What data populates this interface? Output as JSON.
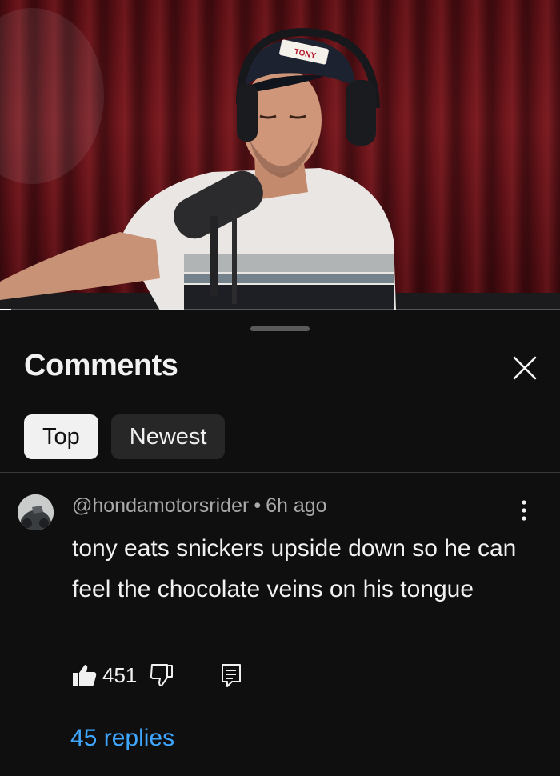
{
  "video": {
    "cap_text": "TONY",
    "progress_fraction": 0.02
  },
  "sheet": {
    "title": "Comments",
    "close_icon": "close-icon",
    "filters": [
      {
        "label": "Top",
        "selected": true
      },
      {
        "label": "Newest",
        "selected": false
      }
    ]
  },
  "comment": {
    "author": "@hondamotorsrider",
    "separator": "•",
    "time": "6h ago",
    "text": "tony eats snickers upside down so he can feel the chocolate veins on his tongue",
    "like_count": "451",
    "replies_label": "45 replies",
    "icons": [
      "thumbs-up-icon",
      "thumbs-down-icon",
      "reply-icon",
      "more-vert-icon"
    ]
  },
  "colors": {
    "background": "#0f0f0f",
    "link": "#3ea6ff",
    "chip_selected": "#f1f1f1",
    "chip_unselected": "#272727"
  }
}
